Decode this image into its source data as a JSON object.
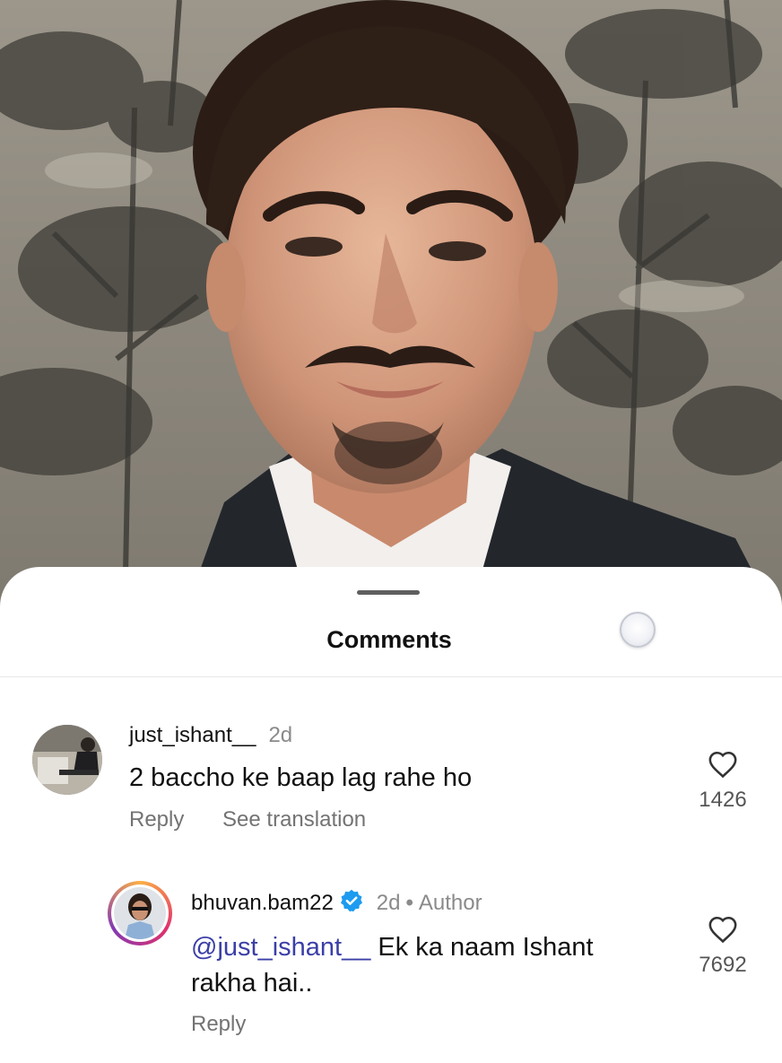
{
  "sheet": {
    "title": "Comments"
  },
  "comments": [
    {
      "username": "just_ishant__",
      "time": "2d",
      "text": "2 baccho ke baap lag rahe ho",
      "reply_label": "Reply",
      "translate_label": "See translation",
      "like_count": "1426"
    }
  ],
  "replies": [
    {
      "username": "bhuvan.bam22",
      "verified": true,
      "time": "2d",
      "separator": "•",
      "author_label": "Author",
      "mention": "@just_ishant__",
      "text_line1": " Ek ka naam Ishant",
      "text_line2": "rakha hai..",
      "reply_label": "Reply",
      "like_count": "7692"
    }
  ],
  "icons": {
    "like": "heart-outline-icon",
    "verified": "verified-badge-icon",
    "loader": "loading-spinner-icon"
  },
  "colors": {
    "mention": "#3b3fa6",
    "verified": "#1d9bf0",
    "secondary_text": "#8a8a8a"
  }
}
